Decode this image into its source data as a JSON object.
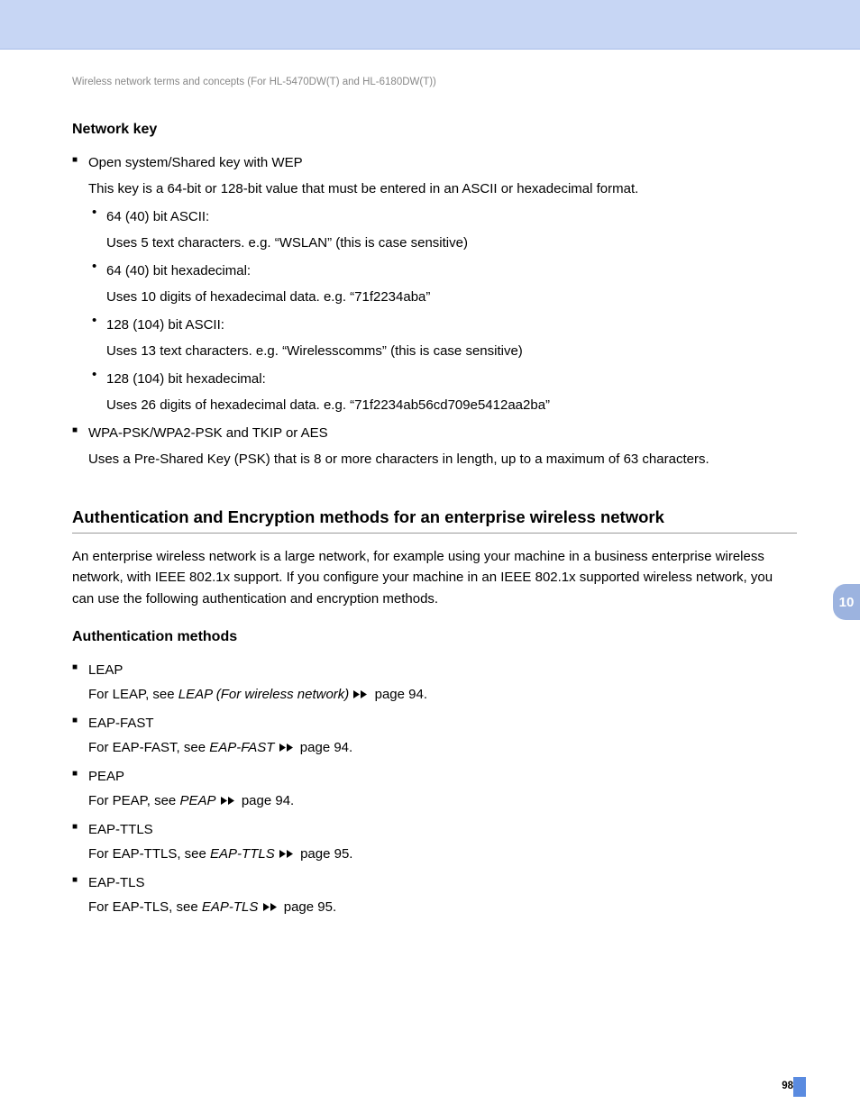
{
  "breadcrumb": "Wireless network terms and concepts (For HL-5470DW(T) and HL-6180DW(T))",
  "section1": {
    "title": "Network key",
    "items": [
      {
        "label": "Open system/Shared key with WEP",
        "desc": "This key is a 64-bit or 128-bit value that must be entered in an ASCII or hexadecimal format.",
        "sub": [
          {
            "label": "64 (40) bit ASCII:",
            "desc": "Uses 5 text characters. e.g. “WSLAN” (this is case sensitive)"
          },
          {
            "label": "64 (40) bit hexadecimal:",
            "desc": "Uses 10 digits of hexadecimal data. e.g. “71f2234aba”"
          },
          {
            "label": "128 (104) bit ASCII:",
            "desc": "Uses 13 text characters. e.g. “Wirelesscomms” (this is case sensitive)"
          },
          {
            "label": "128 (104) bit hexadecimal:",
            "desc": "Uses 26 digits of hexadecimal data. e.g. “71f2234ab56cd709e5412aa2ba”"
          }
        ]
      },
      {
        "label": "WPA-PSK/WPA2-PSK and TKIP or AES",
        "desc": "Uses a Pre-Shared Key (PSK) that is 8 or more characters in length, up to a maximum of 63 characters."
      }
    ]
  },
  "section2": {
    "title": "Authentication and Encryption methods for an enterprise wireless network",
    "intro": "An enterprise wireless network is a large network, for example using your machine in a business enterprise wireless network, with IEEE 802.1x support. If you configure your machine in an IEEE 802.1x supported wireless network, you can use the following authentication and encryption methods.",
    "subtitle": "Authentication methods",
    "items": [
      {
        "label": "LEAP",
        "pre": "For LEAP, see ",
        "link": "LEAP (For wireless network)",
        "post": " page 94."
      },
      {
        "label": "EAP-FAST",
        "pre": "For EAP-FAST, see ",
        "link": "EAP-FAST",
        "post": " page 94."
      },
      {
        "label": "PEAP",
        "pre": "For PEAP, see ",
        "link": "PEAP",
        "post": " page 94."
      },
      {
        "label": "EAP-TTLS",
        "pre": "For EAP-TTLS, see ",
        "link": "EAP-TTLS",
        "post": " page 95."
      },
      {
        "label": "EAP-TLS",
        "pre": "For EAP-TLS, see ",
        "link": "EAP-TLS",
        "post": " page 95."
      }
    ]
  },
  "tab": "10",
  "pageNumber": "98"
}
